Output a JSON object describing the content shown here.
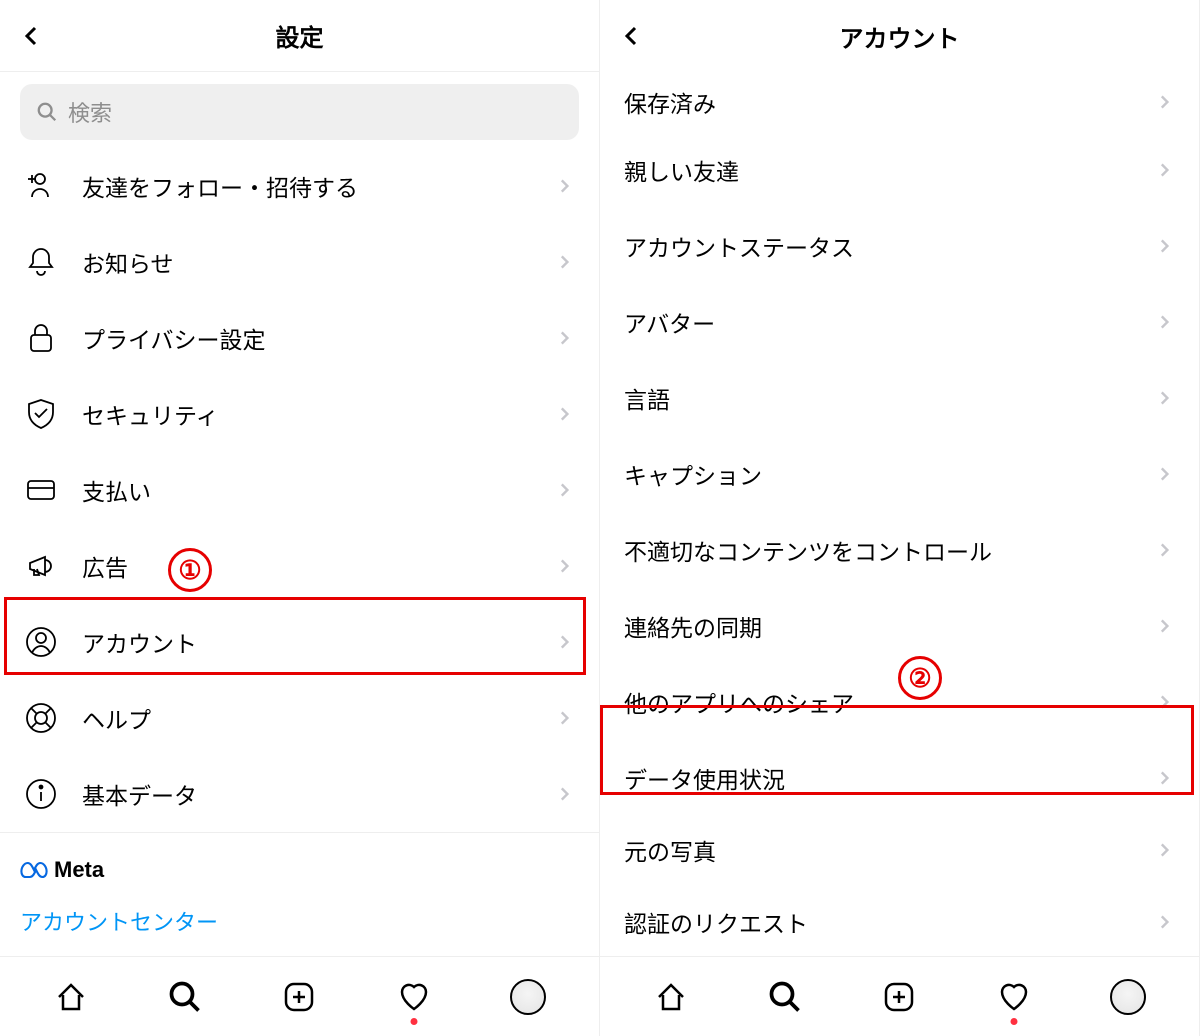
{
  "left": {
    "title": "設定",
    "search_placeholder": "検索",
    "items": [
      {
        "label": "友達をフォロー・招待する",
        "icon": "user-plus"
      },
      {
        "label": "お知らせ",
        "icon": "bell"
      },
      {
        "label": "プライバシー設定",
        "icon": "lock"
      },
      {
        "label": "セキュリティ",
        "icon": "shield-check"
      },
      {
        "label": "支払い",
        "icon": "card"
      },
      {
        "label": "広告",
        "icon": "megaphone"
      },
      {
        "label": "アカウント",
        "icon": "user-circle"
      },
      {
        "label": "ヘルプ",
        "icon": "buoy"
      },
      {
        "label": "基本データ",
        "icon": "info"
      }
    ],
    "meta_label": "Meta",
    "account_center_link": "アカウントセンター"
  },
  "right": {
    "title": "アカウント",
    "items": [
      {
        "label": "保存済み"
      },
      {
        "label": "親しい友達"
      },
      {
        "label": "アカウントステータス"
      },
      {
        "label": "アバター"
      },
      {
        "label": "言語"
      },
      {
        "label": "キャプション"
      },
      {
        "label": "不適切なコンテンツをコントロール"
      },
      {
        "label": "連絡先の同期"
      },
      {
        "label": "他のアプリへのシェア"
      },
      {
        "label": "データ使用状況"
      },
      {
        "label": "元の写真"
      },
      {
        "label": "認証のリクエスト"
      }
    ]
  },
  "annotations": {
    "one": "①",
    "two": "②"
  }
}
